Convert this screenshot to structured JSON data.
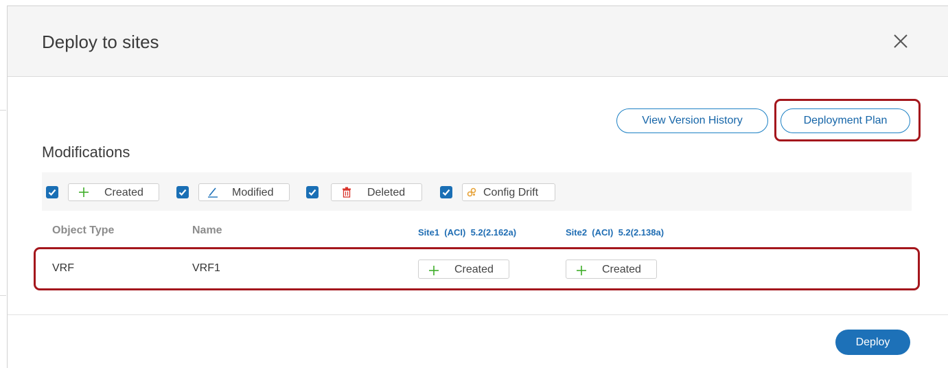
{
  "dialog": {
    "title": "Deploy to sites"
  },
  "toolbar": {
    "version_history_label": "View Version History",
    "deployment_plan_label": "Deployment Plan"
  },
  "section": {
    "title": "Modifications"
  },
  "filters": [
    {
      "label": "Created",
      "checked": true,
      "icon": "plus-icon"
    },
    {
      "label": "Modified",
      "checked": true,
      "icon": "pencil-icon"
    },
    {
      "label": "Deleted",
      "checked": true,
      "icon": "trash-icon"
    },
    {
      "label": "Config Drift",
      "checked": true,
      "icon": "drift-icon"
    }
  ],
  "table": {
    "columns": {
      "object_type": "Object Type",
      "name": "Name",
      "site1": "Site1  (ACI)  5.2(2.162a)",
      "site2": "Site2  (ACI)  5.2(2.138a)"
    },
    "rows": [
      {
        "object_type": "VRF",
        "name": "VRF1",
        "site1_status": "Created",
        "site2_status": "Created"
      }
    ]
  },
  "footer": {
    "deploy_label": "Deploy"
  },
  "colors": {
    "accent": "#1d71b8",
    "highlight": "#a4161c",
    "created_icon": "#3fae29",
    "deleted_icon": "#d9342b",
    "drift_icon": "#e7a33a"
  }
}
